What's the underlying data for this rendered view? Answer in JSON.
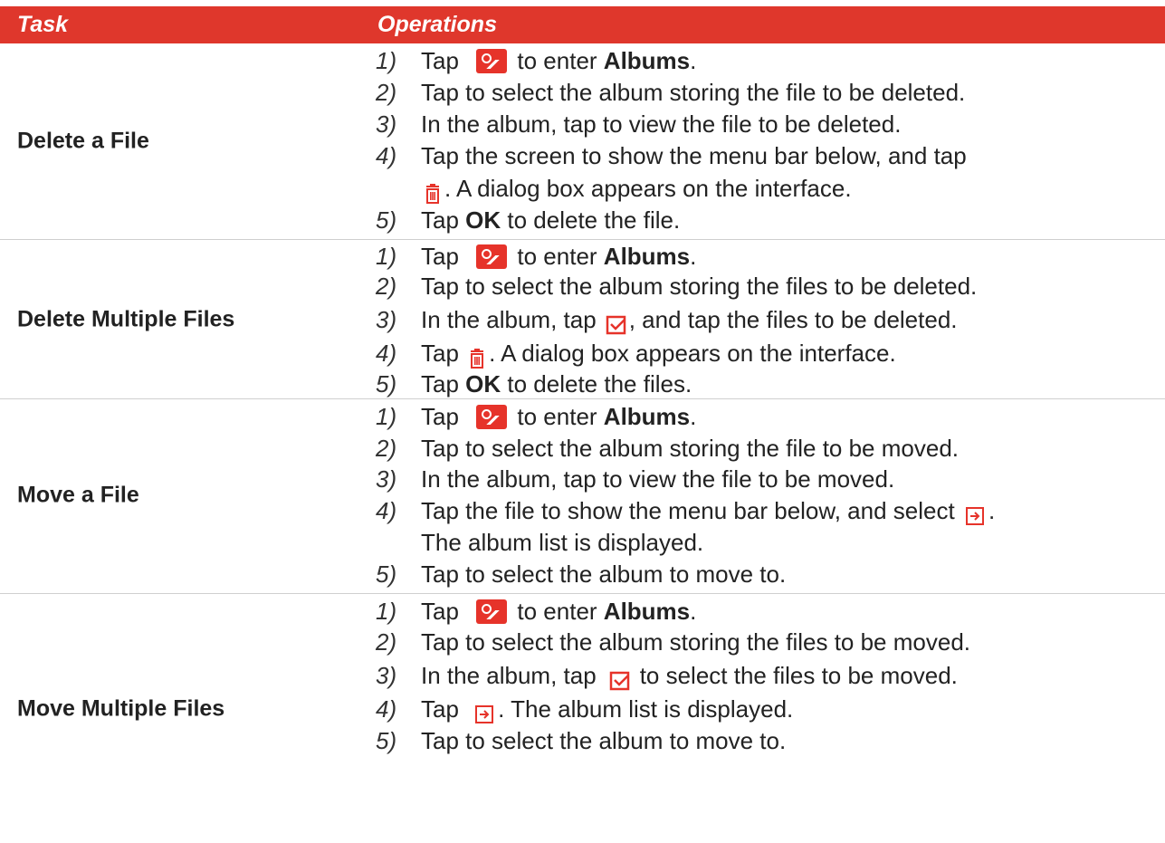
{
  "header": {
    "task": "Task",
    "operations": "Operations"
  },
  "sections": [
    {
      "task": "Delete a File",
      "steps": [
        {
          "num": "1)",
          "pre": "Tap",
          "post": "to enter",
          "bold": "Albums",
          "tail": "."
        },
        {
          "num": "2)",
          "text": "Tap to select the album storing the file to be deleted."
        },
        {
          "num": "3)",
          "text": "In the album, tap to view the file to be deleted."
        },
        {
          "num": "4)",
          "text": "Tap the screen to show the menu bar below, and tap",
          "cont": ". A dialog box appears on the interface."
        },
        {
          "num": "5)",
          "pre": "Tap",
          "bold": "OK",
          "post": "to delete the file."
        }
      ]
    },
    {
      "task": "Delete Multiple Files",
      "steps": [
        {
          "num": "1)",
          "pre": "Tap",
          "post": "to enter",
          "bold": "Albums",
          "tail": "."
        },
        {
          "num": "2)",
          "text": "Tap to select the album storing the files to be deleted."
        },
        {
          "num": "3)",
          "pre": "In the album, tap",
          "post": ", and tap the files to be deleted."
        },
        {
          "num": "4)",
          "pre": "Tap",
          "post": ". A dialog box appears on the interface."
        },
        {
          "num": "5)",
          "pre": "Tap",
          "bold": "OK",
          "post": "to delete the files."
        }
      ]
    },
    {
      "task": "Move a File",
      "steps": [
        {
          "num": "1)",
          "pre": "Tap",
          "post": "to enter",
          "bold": "Albums",
          "tail": "."
        },
        {
          "num": "2)",
          "text": "Tap to select the album storing the file to be moved."
        },
        {
          "num": "3)",
          "text": "In the album, tap to view the file to be moved."
        },
        {
          "num": "4)",
          "pre": "Tap the file to show the menu bar below, and select",
          "post": ".",
          "cont": "The album list is displayed."
        },
        {
          "num": "5)",
          "text": "Tap to select the album to move to."
        }
      ]
    },
    {
      "task": "Move Multiple Files",
      "steps": [
        {
          "num": "1)",
          "pre": "Tap",
          "post": "to enter",
          "bold": "Albums",
          "tail": "."
        },
        {
          "num": "2)",
          "text": "Tap to select the album storing the files to be moved."
        },
        {
          "num": "3)",
          "pre": "In the album, tap",
          "post": "to select the files to be moved."
        },
        {
          "num": "4)",
          "pre": "Tap",
          "post": ". The album list is displayed."
        },
        {
          "num": "5)",
          "text": "Tap to select the album to move to."
        }
      ]
    }
  ],
  "colors": {
    "header_bg": "#df372c",
    "icon_red": "#e6332a",
    "text": "#222222"
  },
  "icons": [
    "album-icon",
    "trash-icon",
    "select-icon",
    "move-to-icon"
  ]
}
